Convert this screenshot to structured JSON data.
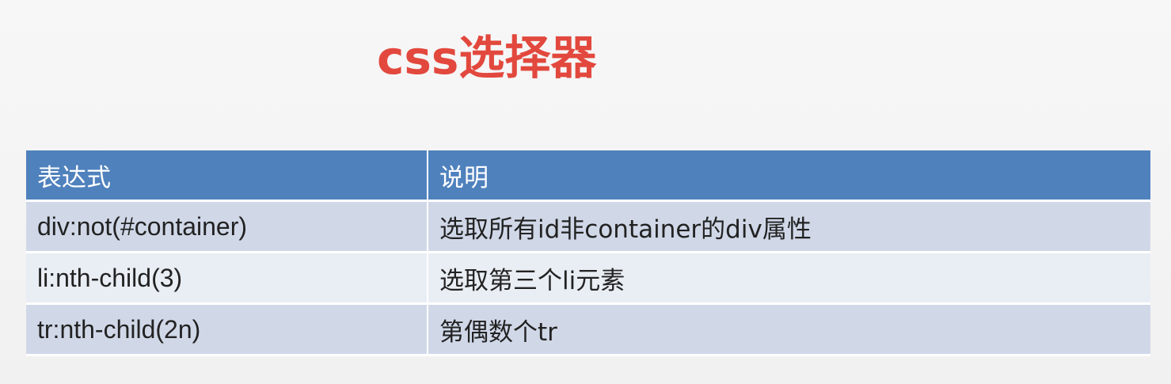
{
  "title": "css选择器",
  "table": {
    "headers": [
      "表达式",
      "说明"
    ],
    "rows": [
      {
        "expression": "div:not(#container)",
        "description": "选取所有id非container的div属性"
      },
      {
        "expression": "li:nth-child(3)",
        "description": "选取第三个li元素"
      },
      {
        "expression": "tr:nth-child(2n)",
        "description": "第偶数个tr"
      }
    ]
  },
  "colors": {
    "title": "#e2483d",
    "header_bg": "#4f81bd",
    "row_bg": "#d0d8e8",
    "row_alt_bg": "#e9edf4"
  }
}
